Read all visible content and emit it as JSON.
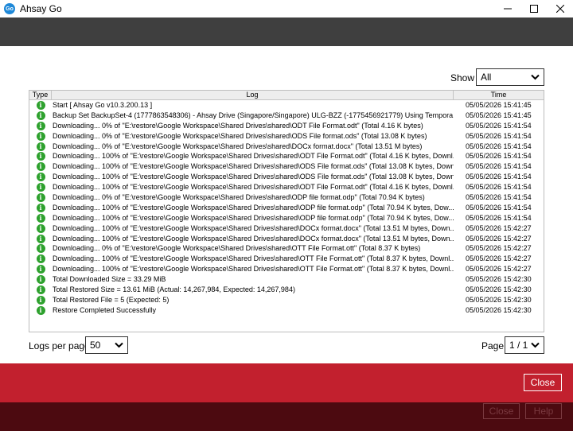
{
  "window": {
    "title": "Ahsay Go",
    "icon_text": "Go"
  },
  "filter": {
    "show_label": "Show",
    "show_value": "All"
  },
  "table": {
    "headers": {
      "type": "Type",
      "log": "Log",
      "time": "Time"
    },
    "rows": [
      {
        "type": "info",
        "log": "Start [ Ahsay Go v10.3.200.13 ]",
        "time": "05/05/2026 15:41:45"
      },
      {
        "type": "info",
        "log": "Backup Set BackupSet-4 (1777863548306) - Ahsay Drive (Singapore/Singapore) ULG-BZZ (-1775456921779) Using Tempora...",
        "time": "05/05/2026 15:41:45"
      },
      {
        "type": "info",
        "log": "Downloading... 0% of \"E:\\restore\\Google Workspace\\Shared Drives\\shared\\ODT File Format.odt\" (Total 4.16 K bytes)",
        "time": "05/05/2026 15:41:54"
      },
      {
        "type": "info",
        "log": "Downloading... 0% of \"E:\\restore\\Google Workspace\\Shared Drives\\shared\\ODS File format.ods\" (Total 13.08 K bytes)",
        "time": "05/05/2026 15:41:54"
      },
      {
        "type": "info",
        "log": "Downloading... 0% of \"E:\\restore\\Google Workspace\\Shared Drives\\shared\\DOCx format.docx\" (Total 13.51 M bytes)",
        "time": "05/05/2026 15:41:54"
      },
      {
        "type": "info",
        "log": "Downloading... 100% of \"E:\\restore\\Google Workspace\\Shared Drives\\shared\\ODT File Format.odt\" (Total 4.16 K bytes, Downl...",
        "time": "05/05/2026 15:41:54"
      },
      {
        "type": "info",
        "log": "Downloading... 100% of \"E:\\restore\\Google Workspace\\Shared Drives\\shared\\ODS File format.ods\" (Total 13.08 K bytes, Down...",
        "time": "05/05/2026 15:41:54"
      },
      {
        "type": "info",
        "log": "Downloading... 100% of \"E:\\restore\\Google Workspace\\Shared Drives\\shared\\ODS File format.ods\" (Total 13.08 K bytes, Down...",
        "time": "05/05/2026 15:41:54"
      },
      {
        "type": "info",
        "log": "Downloading... 100% of \"E:\\restore\\Google Workspace\\Shared Drives\\shared\\ODT File Format.odt\" (Total 4.16 K bytes, Downl...",
        "time": "05/05/2026 15:41:54"
      },
      {
        "type": "info",
        "log": "Downloading... 0% of \"E:\\restore\\Google Workspace\\Shared Drives\\shared\\ODP file format.odp\" (Total 70.94 K bytes)",
        "time": "05/05/2026 15:41:54"
      },
      {
        "type": "info",
        "log": "Downloading... 100% of \"E:\\restore\\Google Workspace\\Shared Drives\\shared\\ODP file format.odp\" (Total 70.94 K bytes, Dow...",
        "time": "05/05/2026 15:41:54"
      },
      {
        "type": "info",
        "log": "Downloading... 100% of \"E:\\restore\\Google Workspace\\Shared Drives\\shared\\ODP file format.odp\" (Total 70.94 K bytes, Dow...",
        "time": "05/05/2026 15:41:54"
      },
      {
        "type": "info",
        "log": "Downloading... 100% of \"E:\\restore\\Google Workspace\\Shared Drives\\shared\\DOCx format.docx\" (Total 13.51 M bytes, Down...",
        "time": "05/05/2026 15:42:27"
      },
      {
        "type": "info",
        "log": "Downloading... 100% of \"E:\\restore\\Google Workspace\\Shared Drives\\shared\\DOCx format.docx\" (Total 13.51 M bytes, Down...",
        "time": "05/05/2026 15:42:27"
      },
      {
        "type": "info",
        "log": "Downloading... 0% of \"E:\\restore\\Google Workspace\\Shared Drives\\shared\\OTT File Format.ott\" (Total 8.37 K bytes)",
        "time": "05/05/2026 15:42:27"
      },
      {
        "type": "info",
        "log": "Downloading... 100% of \"E:\\restore\\Google Workspace\\Shared Drives\\shared\\OTT File Format.ott\" (Total 8.37 K bytes, Downl...",
        "time": "05/05/2026 15:42:27"
      },
      {
        "type": "info",
        "log": "Downloading... 100% of \"E:\\restore\\Google Workspace\\Shared Drives\\shared\\OTT File Format.ott\" (Total 8.37 K bytes, Downl...",
        "time": "05/05/2026 15:42:27"
      },
      {
        "type": "info",
        "log": "Total Downloaded Size = 33.29 MiB",
        "time": "05/05/2026 15:42:30"
      },
      {
        "type": "info",
        "log": "Total Restored Size = 13.61 MiB (Actual: 14,267,984, Expected: 14,267,984)",
        "time": "05/05/2026 15:42:30"
      },
      {
        "type": "info",
        "log": "Total Restored File = 5 (Expected: 5)",
        "time": "05/05/2026 15:42:30"
      },
      {
        "type": "info",
        "log": "Restore Completed Successfully",
        "time": "05/05/2026 15:42:30"
      }
    ]
  },
  "pagination": {
    "logs_per_page_label": "Logs per page",
    "logs_per_page_value": "50",
    "page_label": "Page",
    "page_value": "1 / 1"
  },
  "dialog": {
    "close_label": "Close"
  },
  "background_buttons": {
    "close_label": "Close",
    "help_label": "Help"
  },
  "colors": {
    "top_band": "#3f3f3f",
    "red_band": "#c2202e",
    "bottom_band": "#4c0a10",
    "info_icon": "#2ea12e"
  }
}
